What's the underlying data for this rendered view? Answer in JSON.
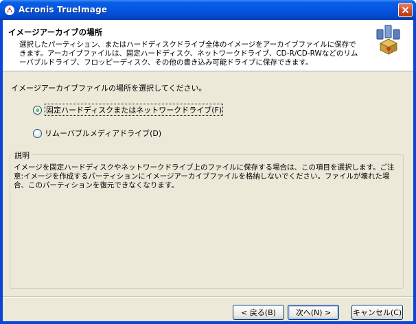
{
  "window": {
    "title": "Acronis TrueImage"
  },
  "header": {
    "title": "イメージアーカイブの場所",
    "description": "選択したパーティション、またはハードディスクドライブ全体のイメージをアーカイブファイルに保存できます。アーカイブファイルは、固定ハードディスク、ネットワークドライブ、CD-R/CD-RWなどのリムーバブルドライブ、フロッピーディスク、その他の書き込み可能ドライブに保存できます。"
  },
  "main": {
    "prompt": "イメージアーカイブファイルの場所を選択してください。",
    "options": [
      {
        "label": "固定ハードディスクまたはネットワークドライブ(F)",
        "checked": true
      },
      {
        "label": "リムーバブルメディアドライブ(D)",
        "checked": false
      }
    ]
  },
  "description_group": {
    "caption": "説明",
    "text": "イメージを固定ハードディスクやネットワークドライブ上のファイルに保存する場合は、この項目を選択します。ご注意:イメージを作成するパーティションにイメージアーカイブファイルを格納しないでください。ファイルが壊れた場合、このパーティションを復元できなくなります。"
  },
  "buttons": {
    "back": "< 戻る(B)",
    "next": "次へ(N) >",
    "cancel": "キャンセル(C)"
  }
}
